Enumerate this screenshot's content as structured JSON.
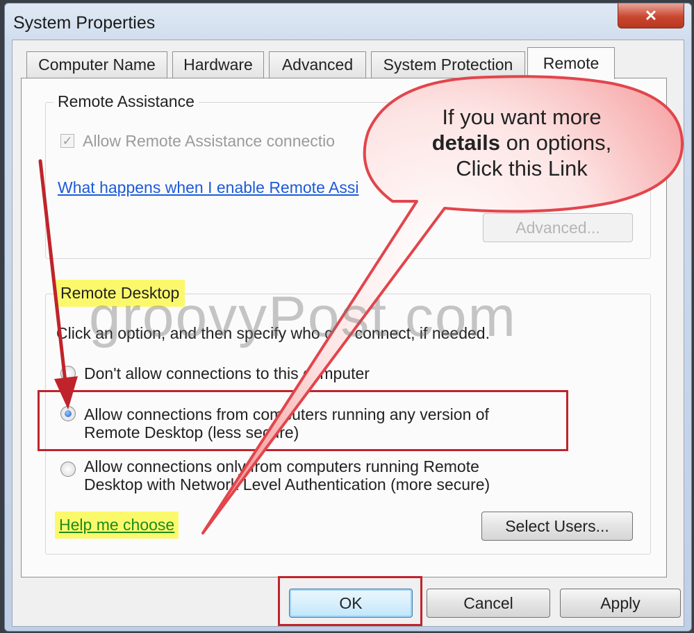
{
  "window": {
    "title": "System Properties",
    "close_symbol": "✕"
  },
  "tabs": [
    {
      "label": "Computer Name",
      "active": false
    },
    {
      "label": "Hardware",
      "active": false
    },
    {
      "label": "Advanced",
      "active": false
    },
    {
      "label": "System Protection",
      "active": false
    },
    {
      "label": "Remote",
      "active": true
    }
  ],
  "remote_assistance": {
    "group_label": "Remote Assistance",
    "checkbox_label": "Allow Remote Assistance connectio",
    "checkbox_checked": true,
    "link_text": "What happens when I enable Remote Assi",
    "advanced_button": "Advanced..."
  },
  "remote_desktop": {
    "group_label": "Remote Desktop",
    "instruction": "Click an option, and then specify who can connect, if needed.",
    "options": [
      {
        "line1": "Don't allow connections to this computer",
        "line2": "",
        "checked": false
      },
      {
        "line1": "Allow connections from computers running any version of",
        "line2": "Remote Desktop (less secure)",
        "checked": true
      },
      {
        "line1": "Allow connections only from computers running Remote",
        "line2": "Desktop with Network Level Authentication (more secure)",
        "checked": false
      }
    ],
    "help_link": "Help me choose",
    "select_users_button": "Select Users..."
  },
  "footer": {
    "ok": "OK",
    "cancel": "Cancel",
    "apply": "Apply"
  },
  "callout": {
    "line1": "If you want more",
    "line2_bold": "details",
    "line2_rest": " on options,",
    "line3": "Click this Link"
  },
  "watermark": "groovyPost.com",
  "colors": {
    "highlight": "#fbf96b",
    "annotation_red": "#c0232b",
    "callout_fill": "#ffd0d0",
    "link_blue": "#1b5ad8"
  }
}
